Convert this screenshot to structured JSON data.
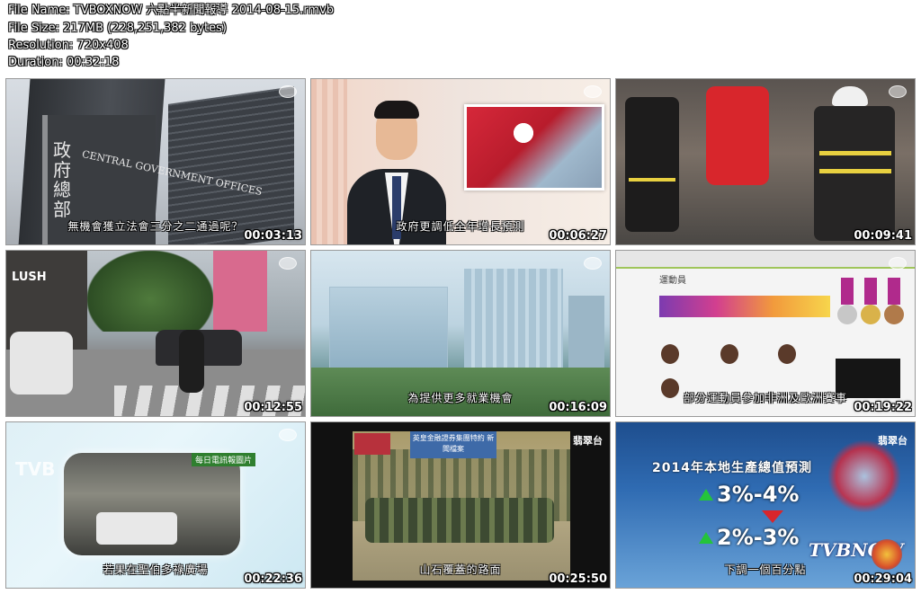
{
  "file_info": {
    "file_name": "File Name: TVBOXNOW 六點半新聞報導 2014-08-15.rmvb",
    "file_size": "File Size: 217MB (228,251,382 bytes)",
    "resolution": "Resolution: 720x408",
    "duration": "Duration: 00:32:18"
  },
  "thumbnails": [
    {
      "timestamp": "00:03:13",
      "subtitle": "無機會獲立法會三分之二通過呢？",
      "overlay_text": "政府總部",
      "overlay_en": "CENTRAL GOVERNMENT OFFICES"
    },
    {
      "timestamp": "00:06:27",
      "subtitle": "政府更調低全年增長預測"
    },
    {
      "timestamp": "00:09:41"
    },
    {
      "timestamp": "00:12:55",
      "overlay_text": "LUSH"
    },
    {
      "timestamp": "00:16:09",
      "subtitle": "為提供更多就業機會"
    },
    {
      "timestamp": "00:19:22",
      "subtitle": "部分運動員參加非洲及歐洲賽事",
      "overlay_text": "運動員"
    },
    {
      "timestamp": "00:22:36",
      "subtitle": "若果在聖伯多祿廣場",
      "overlay_tag": "每日電訊報圖片",
      "overlay_text": "TVB"
    },
    {
      "timestamp": "00:25:50",
      "subtitle": "山石覆蓋的路面",
      "overlay_banner": "英皇金融證券集團特約 新聞檔案",
      "channel": "翡翠台"
    },
    {
      "timestamp": "00:29:04",
      "subtitle": "下調一個百分點",
      "headline": "2014年本地生產總值預測",
      "range_old": "3%-4%",
      "range_new": "2%-3%",
      "watermark": "TVBNOW",
      "channel": "翡翠台"
    }
  ],
  "colors": {
    "text_outline": "#000000",
    "text_fill": "#ffffff",
    "up_arrow": "#24c43a",
    "down_arrow": "#d8262c"
  }
}
